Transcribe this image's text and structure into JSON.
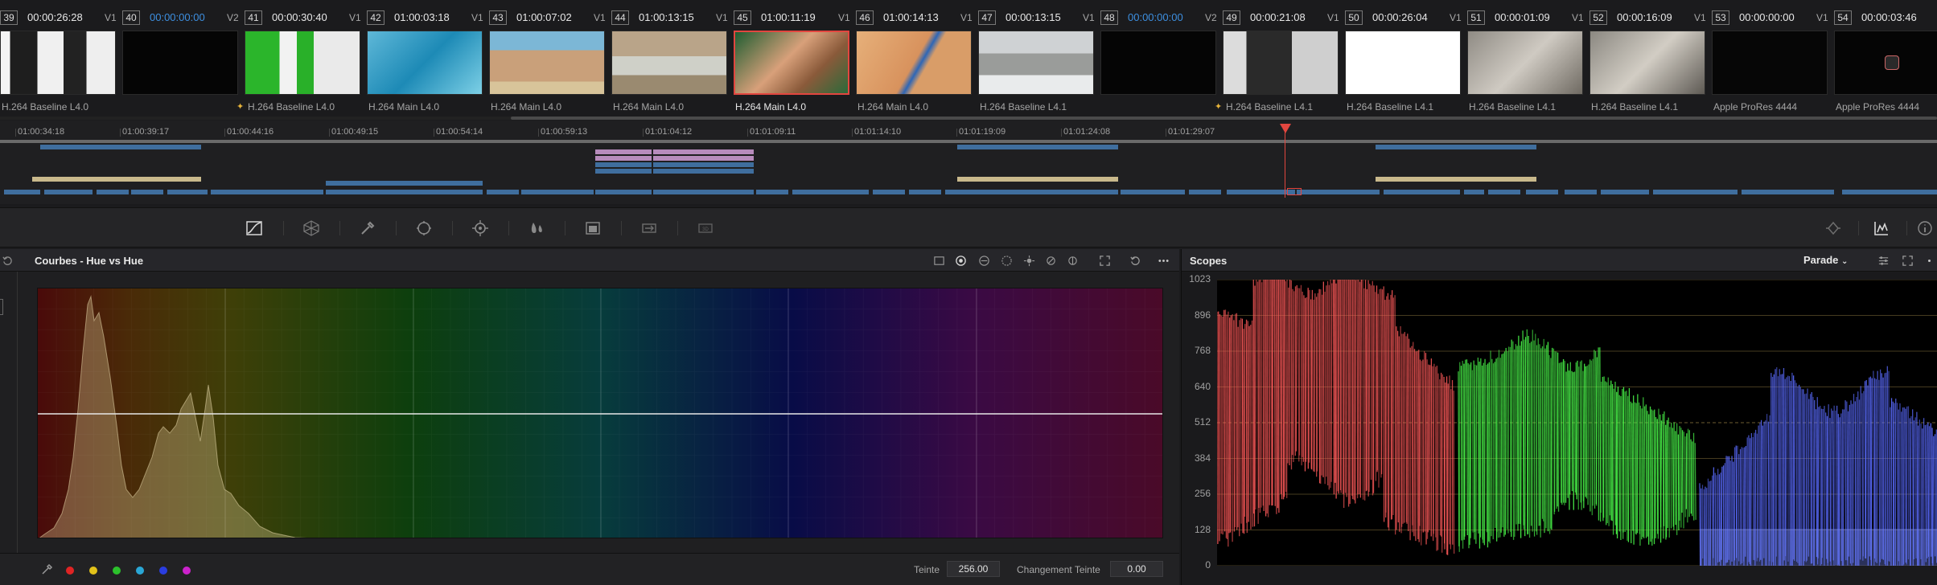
{
  "clips": [
    {
      "num": "39",
      "timecode": "00:00:26:28",
      "track": "V1",
      "codec": "H.264 Baseline L4.0",
      "starred": false,
      "tc_blue": false
    },
    {
      "num": "40",
      "timecode": "00:00:00:00",
      "track": "V2",
      "codec": "",
      "starred": true,
      "tc_blue": true
    },
    {
      "num": "41",
      "timecode": "00:00:30:40",
      "track": "V1",
      "codec": "H.264 Baseline L4.0",
      "starred": false,
      "tc_blue": false
    },
    {
      "num": "42",
      "timecode": "01:00:03:18",
      "track": "V1",
      "codec": "H.264 Main L4.0",
      "starred": false,
      "tc_blue": false
    },
    {
      "num": "43",
      "timecode": "01:00:07:02",
      "track": "V1",
      "codec": "H.264 Main L4.0",
      "starred": false,
      "tc_blue": false
    },
    {
      "num": "44",
      "timecode": "01:00:13:15",
      "track": "V1",
      "codec": "H.264 Main L4.0",
      "starred": false,
      "tc_blue": false
    },
    {
      "num": "45",
      "timecode": "01:00:11:19",
      "track": "V1",
      "codec": "H.264 Main L4.0",
      "starred": false,
      "tc_blue": false
    },
    {
      "num": "46",
      "timecode": "01:00:14:13",
      "track": "V1",
      "codec": "H.264 Main L4.0",
      "starred": false,
      "tc_blue": false
    },
    {
      "num": "47",
      "timecode": "00:00:13:15",
      "track": "V1",
      "codec": "H.264 Baseline L4.1",
      "starred": false,
      "tc_blue": false
    },
    {
      "num": "48",
      "timecode": "00:00:00:00",
      "track": "V2",
      "codec": "",
      "starred": true,
      "tc_blue": true
    },
    {
      "num": "49",
      "timecode": "00:00:21:08",
      "track": "V1",
      "codec": "H.264 Baseline L4.1",
      "starred": false,
      "tc_blue": false
    },
    {
      "num": "50",
      "timecode": "00:00:26:04",
      "track": "V1",
      "codec": "H.264 Baseline L4.1",
      "starred": false,
      "tc_blue": false
    },
    {
      "num": "51",
      "timecode": "00:00:01:09",
      "track": "V1",
      "codec": "H.264 Baseline L4.1",
      "starred": false,
      "tc_blue": false
    },
    {
      "num": "52",
      "timecode": "00:00:16:09",
      "track": "V1",
      "codec": "H.264 Baseline L4.1",
      "starred": false,
      "tc_blue": false
    },
    {
      "num": "53",
      "timecode": "00:00:00:00",
      "track": "V1",
      "codec": "Apple ProRes 4444",
      "starred": false,
      "tc_blue": false
    },
    {
      "num": "54",
      "timecode": "00:00:03:46",
      "track": "",
      "codec": "Apple ProRes 4444",
      "starred": false,
      "tc_blue": false
    }
  ],
  "selected_clip": "45",
  "ruler_ticks": [
    "01:00:34:18",
    "01:00:39:17",
    "01:00:44:16",
    "01:00:49:15",
    "01:00:54:14",
    "01:00:59:13",
    "01:01:04:12",
    "01:01:09:11",
    "01:01:14:10",
    "01:01:19:09",
    "01:01:24:08",
    "01:01:29:07"
  ],
  "toolbar_icons": [
    "curves-icon",
    "color-warper-icon",
    "qualifier-eyedropper-icon",
    "window-icon",
    "tracker-icon",
    "magic-mask-icon",
    "blur-icon",
    "key-icon",
    "sizing-icon",
    "3d-icon",
    "keyframes-icon",
    "scopes-icon",
    "info-icon"
  ],
  "curves": {
    "title": "Courbes -  Hue vs Hue",
    "hue_label": "Teinte",
    "hue_value": "256.00",
    "change_label": "Changement Teinte",
    "change_value": "0.00",
    "swatches": [
      "#e02424",
      "#e2c21a",
      "#2cc12c",
      "#2aa7d6",
      "#2a3de0",
      "#cc22cc"
    ]
  },
  "scopes": {
    "title": "Scopes",
    "mode": "Parade",
    "scale": [
      "1023",
      "896",
      "768",
      "640",
      "512",
      "384",
      "256",
      "128",
      "0"
    ]
  },
  "colors": {
    "accent_red": "#e2463f",
    "timecode_blue": "#3d8fe0",
    "clip_bar_blue": "#3f6e9e",
    "clip_bar_tan": "#c9b98c",
    "clip_bar_pink": "#b78bbc"
  }
}
